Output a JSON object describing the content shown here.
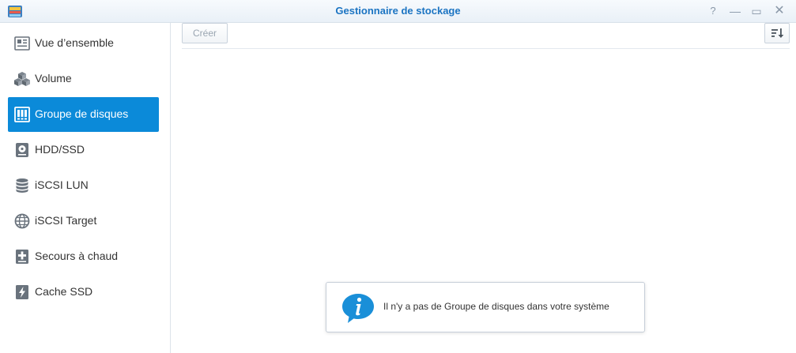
{
  "window": {
    "title": "Gestionnaire de stockage",
    "controls": {
      "help": "?",
      "minimize": "—",
      "maximize": "▭",
      "close": "✕"
    },
    "accent_color": "#0b8ad9",
    "title_color": "#1b74c2"
  },
  "sidebar": {
    "items": [
      {
        "label": "Vue d’ensemble",
        "icon": "overview-icon",
        "active": false
      },
      {
        "label": "Volume",
        "icon": "volume-cubes-icon",
        "active": false
      },
      {
        "label": "Groupe de disques",
        "icon": "disk-group-icon",
        "active": true
      },
      {
        "label": "HDD/SSD",
        "icon": "hdd-icon",
        "active": false
      },
      {
        "label": "iSCSI LUN",
        "icon": "database-icon",
        "active": false
      },
      {
        "label": "iSCSI Target",
        "icon": "globe-icon",
        "active": false
      },
      {
        "label": "Secours à chaud",
        "icon": "hot-spare-icon",
        "active": false
      },
      {
        "label": "Cache SSD",
        "icon": "ssd-cache-icon",
        "active": false
      }
    ]
  },
  "toolbar": {
    "create_label": "Créer",
    "sort_icon": "sort-icon"
  },
  "message": {
    "text": "Il n'y a pas de Groupe de disques dans votre système",
    "icon": "info-icon"
  }
}
